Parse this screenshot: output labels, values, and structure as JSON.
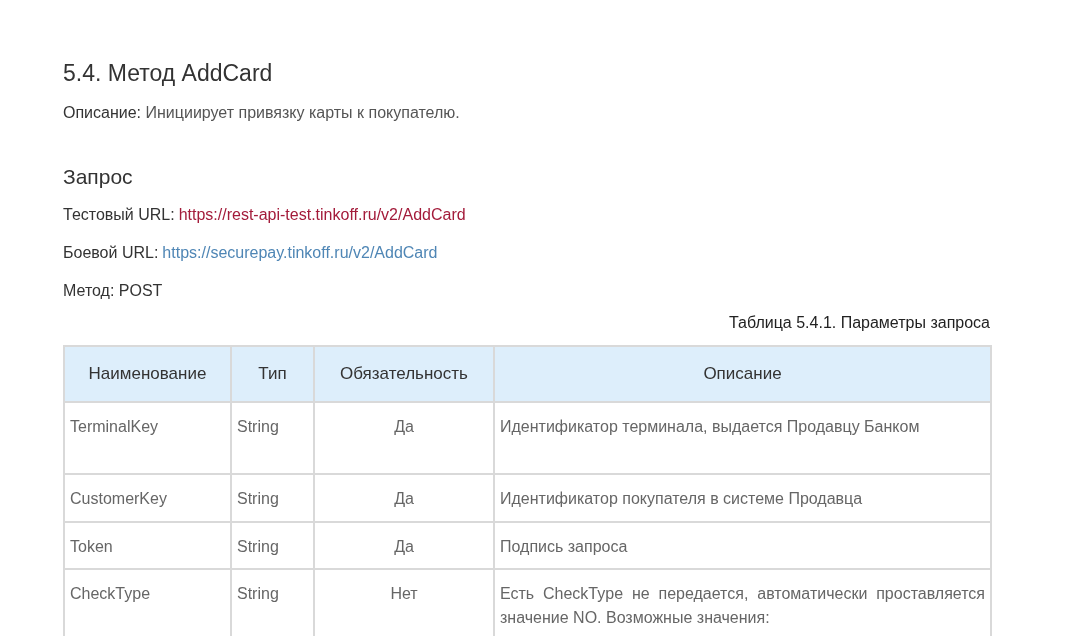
{
  "heading": "5.4. Метод AddCard",
  "description": {
    "label": "Описание:",
    "text": "Инициирует привязку карты к покупателю."
  },
  "section_title": "Запрос",
  "urls": [
    {
      "label": "Тестовый URL:",
      "url": "https://rest-api-test.tinkoff.ru/v2/AddCard",
      "kind": "test"
    },
    {
      "label": "Боевой URL:",
      "url": "https://securepay.tinkoff.ru/v2/AddCard",
      "kind": "production"
    }
  ],
  "method": {
    "label": "Метод:",
    "value": "POST"
  },
  "table": {
    "caption": "Таблица 5.4.1. Параметры запроса",
    "columns": [
      "Наименование",
      "Тип",
      "Обязательность",
      "Описание"
    ],
    "rows": [
      {
        "name": "TerminalKey",
        "type": "String",
        "required": "Да",
        "description": "Идентификатор терминала, выдается Продавцу Банком"
      },
      {
        "name": "CustomerKey",
        "type": "String",
        "required": "Да",
        "description": "Идентификатор покупателя в системе Продавца"
      },
      {
        "name": "Token",
        "type": "String",
        "required": "Да",
        "description": "Подпись запроса"
      },
      {
        "name": "CheckType",
        "type": "String",
        "required": "Нет",
        "description": "Есть CheckType не передается, автоматически проставляется значение NO. Возможные значения:"
      }
    ]
  }
}
